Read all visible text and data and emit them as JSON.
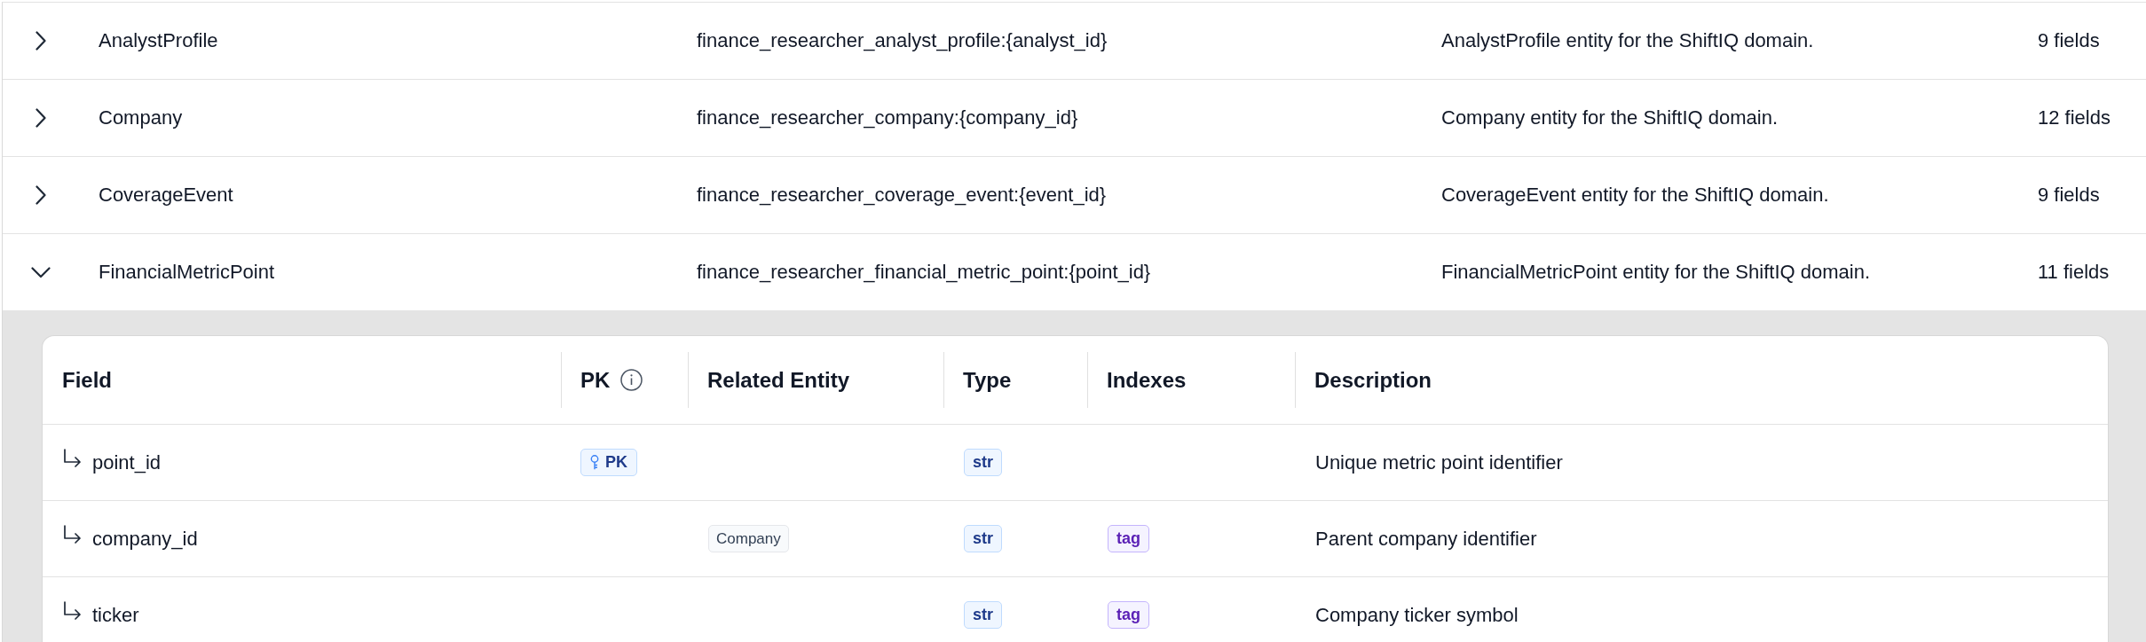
{
  "entities": [
    {
      "name": "AnalystProfile",
      "key_pattern": "finance_researcher_analyst_profile:{analyst_id}",
      "description": "AnalystProfile entity for the ShiftIQ domain.",
      "field_count": "9 fields",
      "expanded": false
    },
    {
      "name": "Company",
      "key_pattern": "finance_researcher_company:{company_id}",
      "description": "Company entity for the ShiftIQ domain.",
      "field_count": "12 fields",
      "expanded": false
    },
    {
      "name": "CoverageEvent",
      "key_pattern": "finance_researcher_coverage_event:{event_id}",
      "description": "CoverageEvent entity for the ShiftIQ domain.",
      "field_count": "9 fields",
      "expanded": false
    },
    {
      "name": "FinancialMetricPoint",
      "key_pattern": "finance_researcher_financial_metric_point:{point_id}",
      "description": "FinancialMetricPoint entity for the ShiftIQ domain.",
      "field_count": "11 fields",
      "expanded": true,
      "fields_table": {
        "columns": [
          {
            "label": "Field",
            "info": false
          },
          {
            "label": "PK",
            "info": true
          },
          {
            "label": "Related Entity",
            "info": false
          },
          {
            "label": "Type",
            "info": false
          },
          {
            "label": "Indexes",
            "info": false
          },
          {
            "label": "Description",
            "info": false
          }
        ],
        "rows": [
          {
            "field": "point_id",
            "pk_badge": "PK",
            "type": "str",
            "description": "Unique metric point identifier"
          },
          {
            "field": "company_id",
            "related_entity": "Company",
            "type": "str",
            "indexes": [
              "tag"
            ],
            "description": "Parent company identifier"
          },
          {
            "field": "ticker",
            "type": "str",
            "indexes": [
              "tag"
            ],
            "description": "Company ticker symbol"
          }
        ]
      }
    }
  ]
}
